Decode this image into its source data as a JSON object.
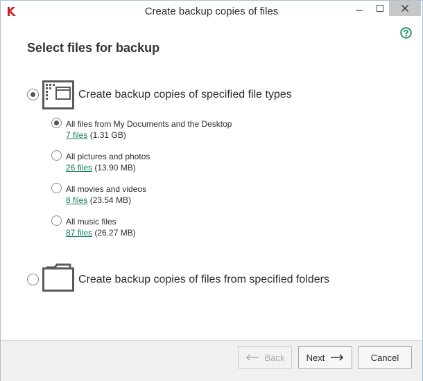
{
  "window": {
    "title": "Create backup copies of files",
    "close_glyph": "✕"
  },
  "page": {
    "heading": "Select files for backup"
  },
  "option_file_types": {
    "label": "Create backup copies of specified file types",
    "selected": true
  },
  "sub_options": [
    {
      "label": "All files from My Documents and the Desktop",
      "files_link": "7 files",
      "size": "(1.31 GB)",
      "selected": true
    },
    {
      "label": "All pictures and photos",
      "files_link": "26 files",
      "size": "(13.90 MB)",
      "selected": false
    },
    {
      "label": "All movies and videos",
      "files_link": "8 files",
      "size": "(23.54 MB)",
      "selected": false
    },
    {
      "label": "All music files",
      "files_link": "87 files",
      "size": "(26.27 MB)",
      "selected": false
    }
  ],
  "option_folders": {
    "label": "Create backup copies of files from specified folders",
    "selected": false
  },
  "footer": {
    "back_label": "Back",
    "next_label": "Next",
    "cancel_label": "Cancel"
  },
  "colors": {
    "accent_link": "#0e7a5f",
    "help_icon": "#1a8a5c",
    "brand_red": "#d0202a"
  },
  "icons": {
    "app": "kaspersky-logo-icon",
    "help": "help-icon",
    "file_types": "window-grid-icon",
    "folders": "folder-icon",
    "back": "arrow-left-icon",
    "next": "arrow-right-icon"
  }
}
